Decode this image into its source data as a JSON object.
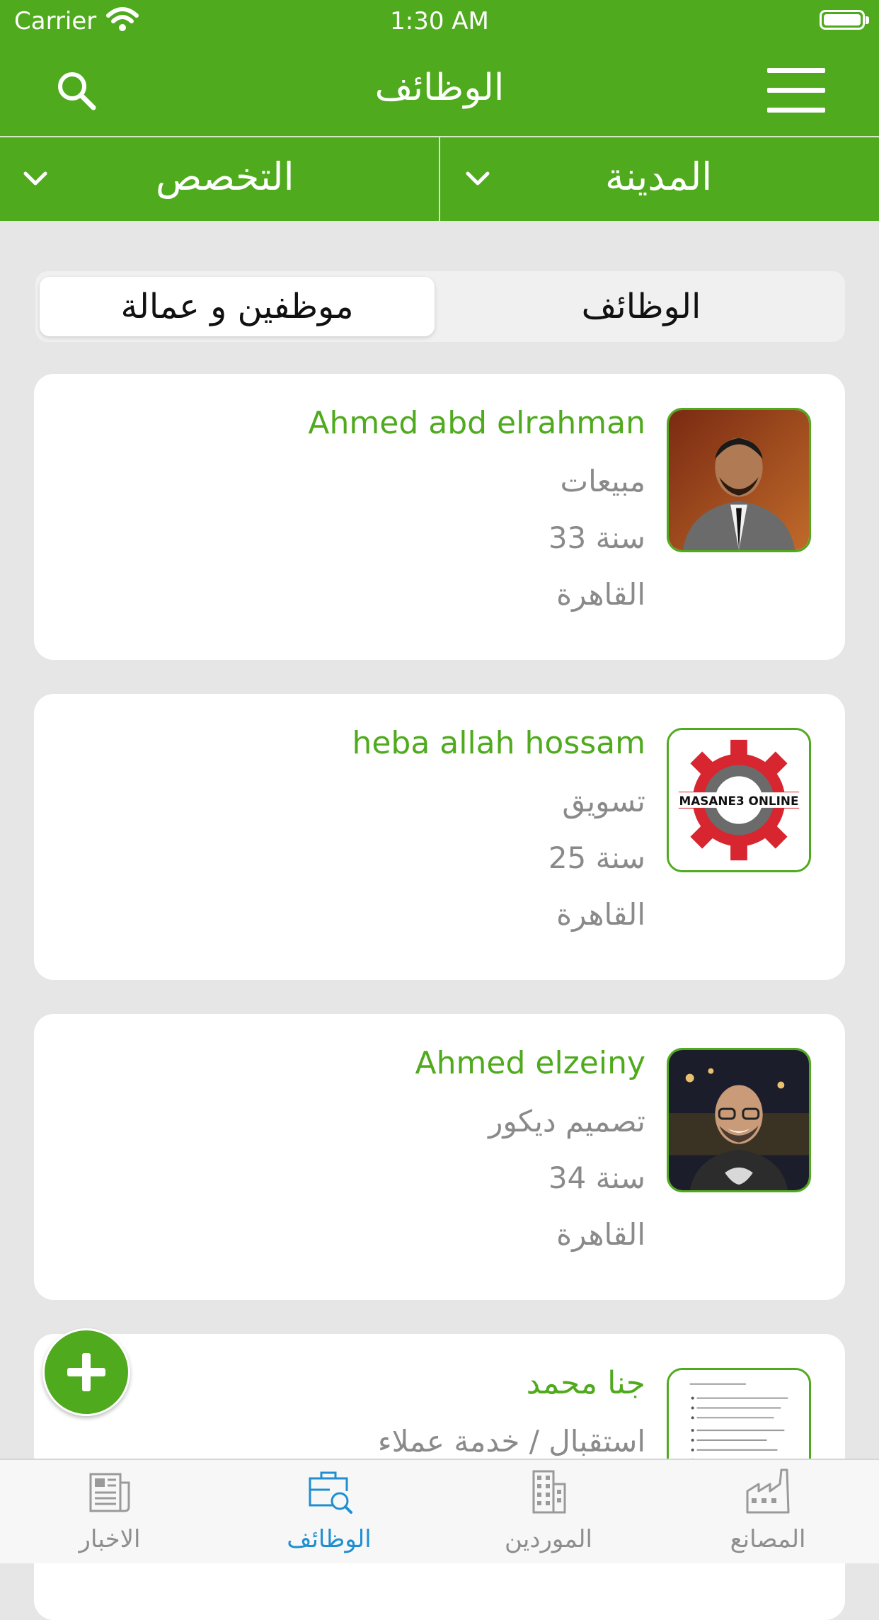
{
  "status_bar": {
    "carrier": "Carrier",
    "time": "1:30 AM"
  },
  "nav": {
    "title": "الوظائف",
    "search_icon": "search-icon",
    "menu_icon": "hamburger-menu-icon"
  },
  "filters": {
    "city_label": "المدينة",
    "specialty_label": "التخصص"
  },
  "segments": {
    "jobs": "الوظائف",
    "workers": "موظفين و عمالة",
    "selected": "workers"
  },
  "cards": [
    {
      "name": "Ahmed abd elrahman",
      "field": "مبيعات",
      "age": "33 سنة",
      "city": "القاهرة",
      "avatar": "profile-photo"
    },
    {
      "name": "heba allah hossam",
      "field": "تسويق",
      "age": "25 سنة",
      "city": "القاهرة",
      "avatar": "masane3-online-logo",
      "logo_text": "MASANE3 ONLINE"
    },
    {
      "name": "Ahmed elzeiny",
      "field": "تصميم ديكور",
      "age": "34 سنة",
      "city": "القاهرة",
      "avatar": "profile-photo"
    },
    {
      "name": "جنا محمد",
      "field": "استقبال / خدمة عملاء",
      "avatar": "cv-document-thumbnail"
    }
  ],
  "tabs": [
    {
      "label": "الاخبار",
      "icon": "newspaper-icon"
    },
    {
      "label": "الوظائف",
      "icon": "briefcase-search-icon",
      "active": true
    },
    {
      "label": "الموردين",
      "icon": "building-icon"
    },
    {
      "label": "المصانع",
      "icon": "factory-icon"
    }
  ],
  "colors": {
    "primary": "#4faa1d",
    "active_tab": "#1f8fd1",
    "muted": "#8a8a8a",
    "background": "#e6e6e6"
  }
}
